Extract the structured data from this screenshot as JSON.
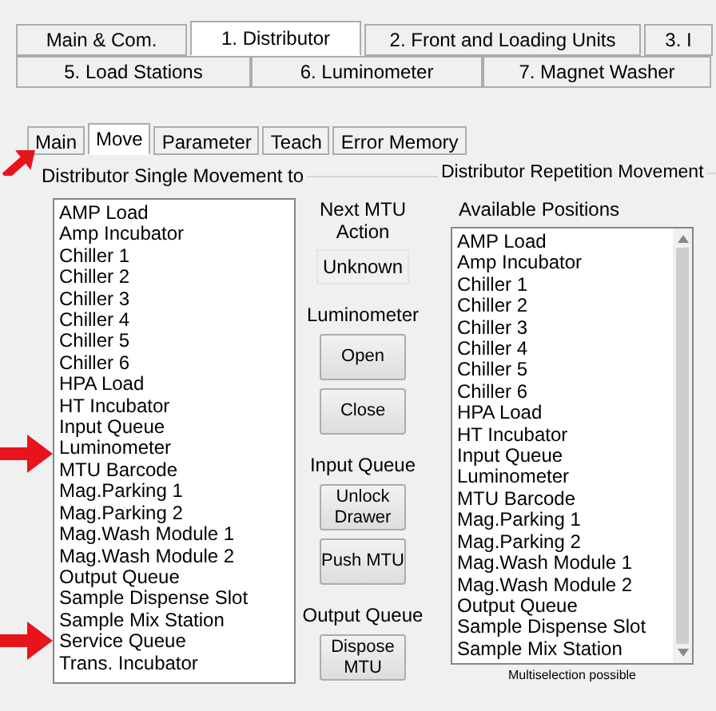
{
  "tabs_row_1": [
    {
      "label": "Main & Com.",
      "selected": false
    },
    {
      "label": "1. Distributor",
      "selected": true
    },
    {
      "label": "2. Front and Loading Units",
      "selected": false
    },
    {
      "label": "3. I",
      "selected": false
    }
  ],
  "tabs_row_2": [
    {
      "label": "5. Load Stations",
      "selected": false
    },
    {
      "label": "6. Luminometer",
      "selected": false
    },
    {
      "label": "7. Magnet Washer",
      "selected": false
    }
  ],
  "sub_tabs": [
    {
      "label": "Main",
      "selected": false
    },
    {
      "label": "Move",
      "selected": true
    },
    {
      "label": "Parameter",
      "selected": false
    },
    {
      "label": "Teach",
      "selected": false
    },
    {
      "label": "Error Memory",
      "selected": false
    }
  ],
  "single_movement": {
    "title": "Distributor Single Movement to",
    "positions": [
      "AMP Load",
      "Amp Incubator",
      "Chiller 1",
      "Chiller 2",
      "Chiller 3",
      "Chiller 4",
      "Chiller 5",
      "Chiller 6",
      "HPA Load",
      "HT Incubator",
      "Input Queue",
      "Luminometer",
      "MTU Barcode",
      "Mag.Parking 1",
      "Mag.Parking 2",
      "Mag.Wash Module 1",
      "Mag.Wash Module 2",
      "Output Queue",
      "Sample Dispense Slot",
      "Sample Mix Station",
      "Service Queue",
      "Trans. Incubator"
    ]
  },
  "next_mtu_action": {
    "label": "Next MTU Action",
    "value": "Unknown"
  },
  "button_groups": [
    {
      "label": "Luminometer",
      "buttons": [
        "Open",
        "Close"
      ]
    },
    {
      "label": "Input Queue",
      "buttons": [
        "Unlock Drawer",
        "Push MTU"
      ]
    },
    {
      "label": "Output Queue",
      "buttons": [
        "Dispose MTU"
      ]
    }
  ],
  "repetition_movement": {
    "title": "Distributor Repetition Movement",
    "list_label": "Available Positions",
    "positions": [
      "AMP Load",
      "Amp Incubator",
      "Chiller 1",
      "Chiller 2",
      "Chiller 3",
      "Chiller 4",
      "Chiller 5",
      "Chiller 6",
      "HPA Load",
      "HT Incubator",
      "Input Queue",
      "Luminometer",
      "MTU Barcode",
      "Mag.Parking 1",
      "Mag.Parking 2",
      "Mag.Wash Module 1",
      "Mag.Wash Module 2",
      "Output Queue",
      "Sample Dispense Slot",
      "Sample Mix Station"
    ],
    "note": "Multiselection possible"
  }
}
